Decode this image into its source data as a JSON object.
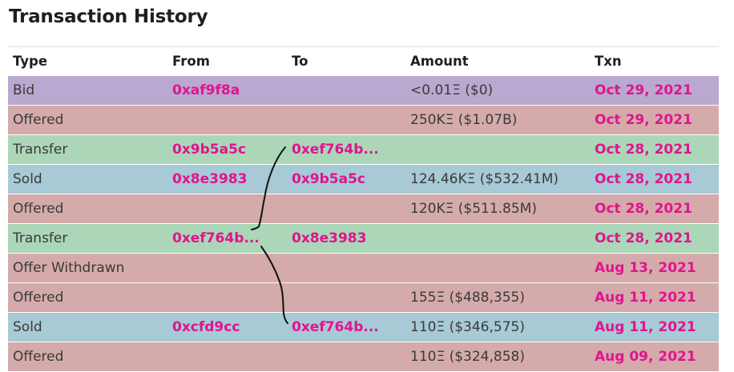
{
  "page": {
    "title": "Transaction History"
  },
  "table": {
    "headers": {
      "type": "Type",
      "from": "From",
      "to": "To",
      "amount": "Amount",
      "txn": "Txn"
    },
    "rows": [
      {
        "kind": "bid",
        "type": "Bid",
        "from": "0xaf9f8a",
        "to": "",
        "amount": "<0.01Ξ ($0)",
        "txn": "Oct 29, 2021"
      },
      {
        "kind": "offered",
        "type": "Offered",
        "from": "",
        "to": "",
        "amount": "250KΞ ($1.07B)",
        "txn": "Oct 29, 2021"
      },
      {
        "kind": "transfer",
        "type": "Transfer",
        "from": "0x9b5a5c",
        "to": "0xef764b...",
        "amount": "",
        "txn": "Oct 28, 2021"
      },
      {
        "kind": "sold",
        "type": "Sold",
        "from": "0x8e3983",
        "to": "0x9b5a5c",
        "amount": "124.46KΞ ($532.41M)",
        "txn": "Oct 28, 2021"
      },
      {
        "kind": "offered",
        "type": "Offered",
        "from": "",
        "to": "",
        "amount": "120KΞ ($511.85M)",
        "txn": "Oct 28, 2021"
      },
      {
        "kind": "transfer",
        "type": "Transfer",
        "from": "0xef764b...",
        "to": "0x8e3983",
        "amount": "",
        "txn": "Oct 28, 2021"
      },
      {
        "kind": "withdrawn",
        "type": "Offer Withdrawn",
        "from": "",
        "to": "",
        "amount": "",
        "txn": "Aug 13, 2021"
      },
      {
        "kind": "offered",
        "type": "Offered",
        "from": "",
        "to": "",
        "amount": "155Ξ ($488,355)",
        "txn": "Aug 11, 2021"
      },
      {
        "kind": "sold",
        "type": "Sold",
        "from": "0xcfd9cc",
        "to": "0xef764b...",
        "amount": "110Ξ ($346,575)",
        "txn": "Aug 11, 2021"
      },
      {
        "kind": "offered",
        "type": "Offered",
        "from": "",
        "to": "",
        "amount": "110Ξ ($324,858)",
        "txn": "Aug 09, 2021"
      }
    ]
  },
  "colors": {
    "bid": "#b9a8cf",
    "offered": "#d5aaaa",
    "transfer": "#acd6b8",
    "sold": "#a8c9d6",
    "withdrawn": "#d5aaaa",
    "link": "#e0148f"
  }
}
